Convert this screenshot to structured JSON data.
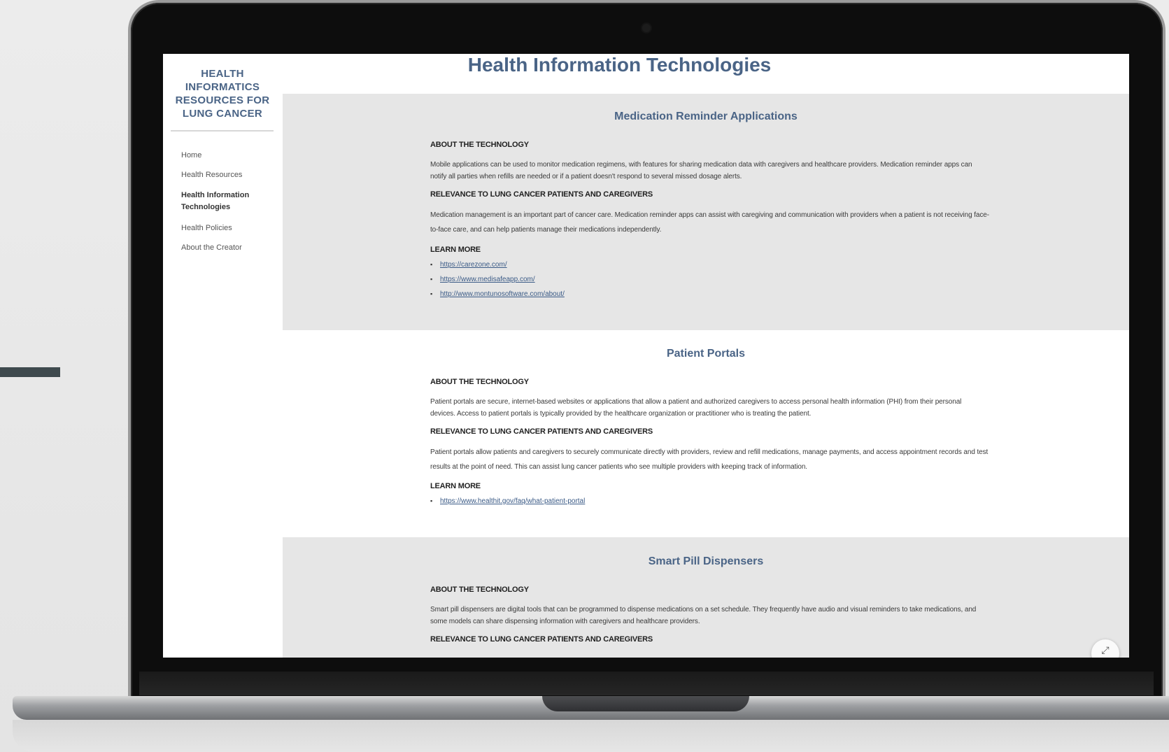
{
  "site": {
    "title": "HEALTH INFORMATICS RESOURCES FOR LUNG CANCER"
  },
  "nav": {
    "items": [
      {
        "label": "Home"
      },
      {
        "label": "Health Resources"
      },
      {
        "label": "Health Information Technologies",
        "active": true
      },
      {
        "label": "Health Policies"
      },
      {
        "label": "About the Creator"
      }
    ]
  },
  "page": {
    "title": "Health Information Technologies"
  },
  "sections": [
    {
      "title": "Medication Reminder Applications",
      "about_label": "ABOUT THE TECHNOLOGY",
      "about_text": "Mobile applications can be used to monitor medication regimens, with features for sharing medication data with caregivers and healthcare providers.  Medication reminder apps can notify all parties when refills are needed or if a patient doesn't respond to several missed dosage alerts.",
      "relevance_label": "RELEVANCE TO LUNG CANCER PATIENTS AND CAREGIVERS",
      "relevance_text": "Medication management is an important part of cancer care. Medication reminder apps can assist with caregiving and communication with providers when a patient is not receiving face-to-face care, and can help patients manage their medications independently.",
      "learn_label": "LEARN MORE",
      "links": [
        "https://carezone.com/",
        "https://www.medisafeapp.com/",
        "http://www.montunosoftware.com/about/"
      ]
    },
    {
      "title": "Patient Portals",
      "about_label": "ABOUT THE TECHNOLOGY",
      "about_text": "Patient portals are secure, internet-based websites or applications that allow a patient and authorized caregivers to access personal health information (PHI) from their personal devices. Access to patient portals is typically provided by the healthcare organization or practitioner who is treating the patient.",
      "relevance_label": "RELEVANCE TO LUNG CANCER PATIENTS AND CAREGIVERS",
      "relevance_text": "Patient portals allow patients and caregivers to securely communicate directly with providers, review and refill medications, manage payments, and access appointment records and test results at the point of need. This can assist lung cancer patients who see multiple providers with keeping track of information.",
      "learn_label": "LEARN MORE",
      "links": [
        "https://www.healthit.gov/faq/what-patient-portal"
      ]
    },
    {
      "title": "Smart Pill Dispensers",
      "about_label": "ABOUT THE TECHNOLOGY",
      "about_text": "Smart pill dispensers are digital tools that can be programmed to dispense medications on a set schedule. They frequently have audio and visual reminders to take medications, and some models can share dispensing information with caregivers and healthcare providers.",
      "relevance_label": "RELEVANCE TO LUNG CANCER PATIENTS AND CAREGIVERS"
    }
  ],
  "icons": {
    "scroll_button": "arrow-icon",
    "fab_glyph": "⤢"
  },
  "colors": {
    "heading": "#4a6486",
    "section_gray": "#e6e6e6",
    "link": "#3a5a86"
  }
}
